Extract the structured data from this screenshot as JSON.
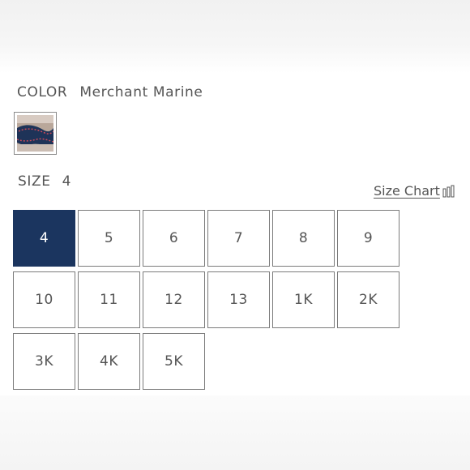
{
  "color": {
    "label": "COLOR",
    "value": "Merchant Marine",
    "swatch_icon": "merchant-marine-swatch"
  },
  "size": {
    "label": "SIZE",
    "selected": "4",
    "chart_link": "Size Chart",
    "chart_icon": "ruler-icon",
    "options": [
      "4",
      "5",
      "6",
      "7",
      "8",
      "9",
      "10",
      "11",
      "12",
      "13",
      "1K",
      "2K",
      "3K",
      "4K",
      "5K"
    ]
  },
  "colors": {
    "selected_bg": "#1b355f",
    "border": "#7b7b7b",
    "text": "#555555"
  }
}
